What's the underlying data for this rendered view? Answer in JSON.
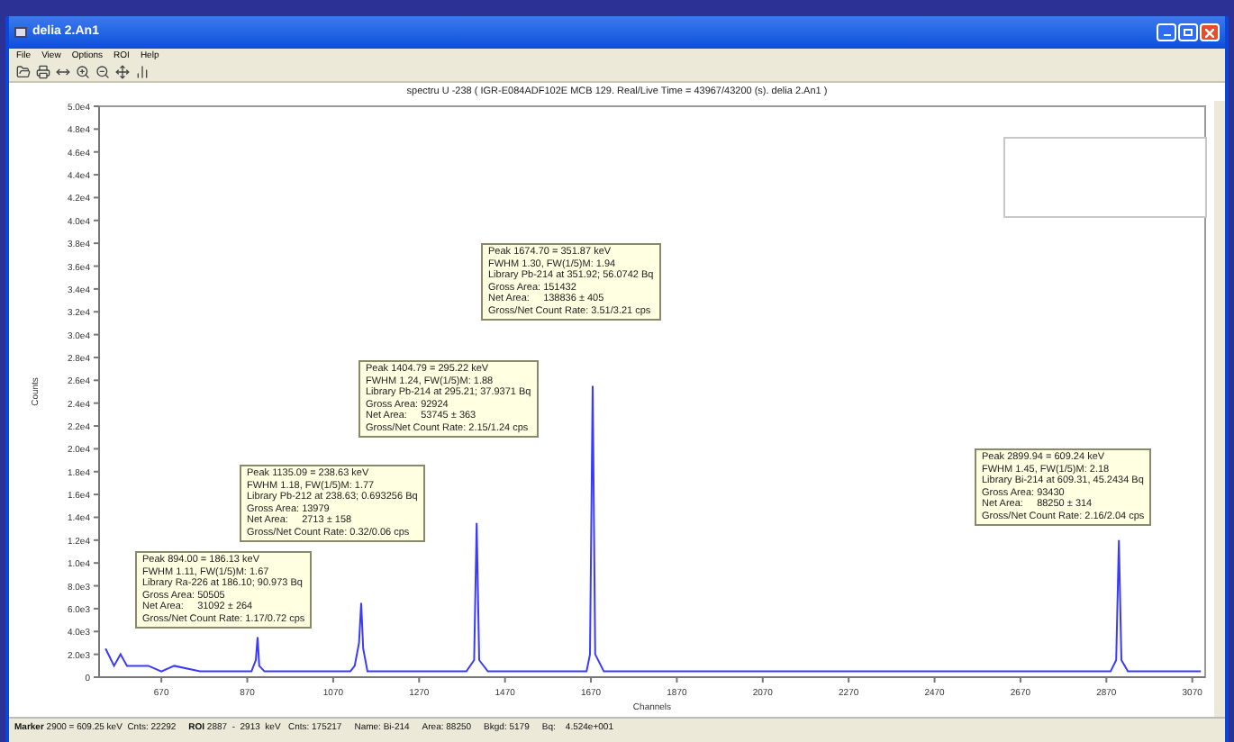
{
  "window": {
    "title": "delia 2.An1"
  },
  "menu": [
    "File",
    "View",
    "Options",
    "ROI",
    "Help"
  ],
  "chart": {
    "title": "spectru U -238 ( IGR-E084ADF102E MCB 129. Real/Live Time = 43967/43200 (s). delia 2.An1 )",
    "chart_data": {
      "type": "line",
      "xlabel": "Channels",
      "ylabel": "Counts",
      "xlim": [
        525,
        3100
      ],
      "ylim": [
        0,
        50000
      ],
      "xticks": [
        670,
        870,
        1070,
        1270,
        1470,
        1670,
        1870,
        2070,
        2270,
        2470,
        2670,
        2870,
        3070
      ],
      "yticks": [
        {
          "value": 0,
          "label": "0"
        },
        {
          "value": 2000,
          "label": "2.0e3"
        },
        {
          "value": 4000,
          "label": "4.0e3"
        },
        {
          "value": 6000,
          "label": "6.0e3"
        },
        {
          "value": 8000,
          "label": "8.0e3"
        },
        {
          "value": 10000,
          "label": "1.0e4"
        },
        {
          "value": 12000,
          "label": "1.2e4"
        },
        {
          "value": 14000,
          "label": "1.4e4"
        },
        {
          "value": 16000,
          "label": "1.6e4"
        },
        {
          "value": 18000,
          "label": "1.8e4"
        },
        {
          "value": 20000,
          "label": "2.0e4"
        },
        {
          "value": 22000,
          "label": "2.2e4"
        },
        {
          "value": 24000,
          "label": "2.4e4"
        },
        {
          "value": 26000,
          "label": "2.6e4"
        },
        {
          "value": 28000,
          "label": "2.8e4"
        },
        {
          "value": 30000,
          "label": "3.0e4"
        },
        {
          "value": 32000,
          "label": "3.2e4"
        },
        {
          "value": 34000,
          "label": "3.4e4"
        },
        {
          "value": 36000,
          "label": "3.6e4"
        },
        {
          "value": 38000,
          "label": "3.8e4"
        },
        {
          "value": 40000,
          "label": "4.0e4"
        },
        {
          "value": 42000,
          "label": "4.2e4"
        },
        {
          "value": 44000,
          "label": "4.4e4"
        },
        {
          "value": 46000,
          "label": "4.6e4"
        },
        {
          "value": 48000,
          "label": "4.8e4"
        },
        {
          "value": 50000,
          "label": "5.0e4"
        }
      ],
      "x": [
        540,
        560,
        575,
        590,
        610,
        640,
        670,
        700,
        760,
        800,
        850,
        880,
        890,
        894,
        898,
        910,
        960,
        1000,
        1060,
        1080,
        1100,
        1110,
        1120,
        1130,
        1135,
        1140,
        1150,
        1200,
        1260,
        1300,
        1380,
        1398,
        1404,
        1410,
        1430,
        1500,
        1600,
        1660,
        1668,
        1674,
        1680,
        1700,
        1800,
        1900,
        2000,
        2100,
        2200,
        2300,
        2400,
        2500,
        2600,
        2700,
        2800,
        2880,
        2893,
        2899,
        2905,
        2920,
        3000,
        3090
      ],
      "series": [
        {
          "color": "#3a3aff",
          "values": [
            2500,
            1000,
            2000,
            1000,
            1000,
            1000,
            500,
            1000,
            500,
            500,
            500,
            500,
            1500,
            3500,
            1000,
            500,
            500,
            500,
            500,
            500,
            500,
            500,
            1000,
            3000,
            6500,
            2500,
            500,
            500,
            500,
            500,
            500,
            1500,
            13500,
            1500,
            500,
            500,
            500,
            500,
            2000,
            25500,
            2000,
            500,
            500,
            500,
            500,
            500,
            500,
            500,
            500,
            500,
            500,
            500,
            500,
            500,
            1500,
            12000,
            1500,
            500,
            500,
            500
          ]
        }
      ]
    },
    "peak_boxes": [
      {
        "lines": [
          "Peak 894.00 = 186.13 keV",
          "FWHM 1.11, FW(1/5)M: 1.67",
          "Library Ra-226 at 186.10; 90.973 Bq",
          "Gross Area: 50505",
          "Net Area:     31092 ± 264",
          "Gross/Net Count Rate: 1.17/0.72 cps"
        ]
      },
      {
        "lines": [
          "Peak 1135.09 = 238.63 keV",
          "FWHM 1.18, FW(1/5)M: 1.77",
          "Library Pb-212 at 238.63; 0.693256 Bq",
          "Gross Area: 13979",
          "Net Area:     2713 ± 158",
          "Gross/Net Count Rate: 0.32/0.06 cps"
        ]
      },
      {
        "lines": [
          "Peak 1404.79 = 295.22 keV",
          "FWHM 1.24, FW(1/5)M: 1.88",
          "Library Pb-214 at 295.21; 37.9371 Bq",
          "Gross Area: 92924",
          "Net Area:     53745 ± 363",
          "Gross/Net Count Rate: 2.15/1.24 cps"
        ]
      },
      {
        "lines": [
          "Peak 1674.70 = 351.87 keV",
          "FWHM 1.30, FW(1/5)M: 1.94",
          "Library Pb-214 at 351.92; 56.0742 Bq",
          "Gross Area: 151432",
          "Net Area:     138836 ± 405",
          "Gross/Net Count Rate: 3.51/3.21 cps"
        ]
      },
      {
        "lines": [
          "Peak 2899.94 = 609.24 keV",
          "FWHM 1.45, FW(1/5)M: 2.18",
          "Library Bi-214 at 609.31, 45.2434 Bq",
          "Gross Area: 93430",
          "Net Area:     88250 ± 314",
          "Gross/Net Count Rate: 2.16/2.04 cps"
        ]
      }
    ]
  },
  "status_bar": [
    "**Marker** 2900 = 609.25 keV  Cnts: 22292",
    "**ROI** 2887  -  2913  keV   Cnts: 175217",
    "Name: Bi-214",
    "Area: 88250",
    "Bkgd: 5179",
    "Bq:    4.524e+001"
  ]
}
